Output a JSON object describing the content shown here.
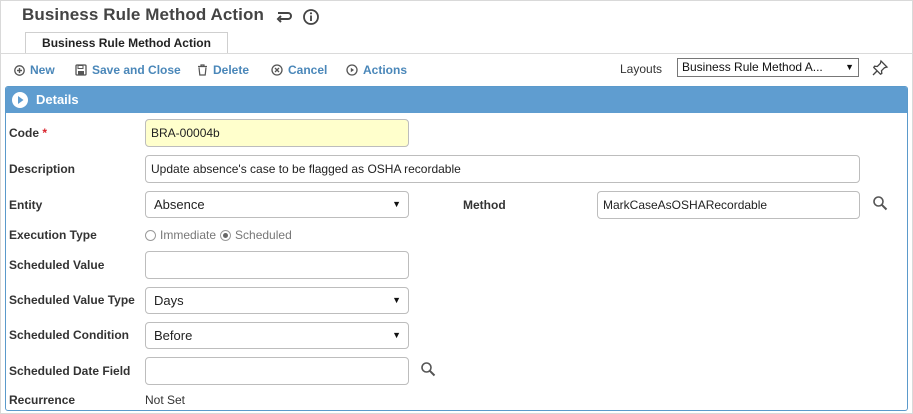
{
  "page": {
    "title": "Business Rule Method Action"
  },
  "tab": {
    "label": "Business Rule Method Action"
  },
  "toolbar": {
    "new": "New",
    "save_close": "Save and Close",
    "delete": "Delete",
    "cancel": "Cancel",
    "actions": "Actions",
    "layouts_label": "Layouts",
    "layouts_value": "Business Rule Method A..."
  },
  "section": {
    "title": "Details"
  },
  "form": {
    "code": {
      "label": "Code",
      "required_marker": "*",
      "value": "BRA-00004b"
    },
    "description": {
      "label": "Description",
      "value": "Update absence's case to be flagged as OSHA recordable"
    },
    "entity": {
      "label": "Entity",
      "value": "Absence"
    },
    "method": {
      "label": "Method",
      "value": "MarkCaseAsOSHARecordable"
    },
    "execution_type": {
      "label": "Execution Type",
      "options": [
        "Immediate",
        "Scheduled"
      ],
      "selected": "Scheduled"
    },
    "scheduled_value": {
      "label": "Scheduled Value",
      "value": ""
    },
    "scheduled_value_type": {
      "label": "Scheduled Value Type",
      "value": "Days"
    },
    "scheduled_condition": {
      "label": "Scheduled Condition",
      "value": "Before"
    },
    "scheduled_date_field": {
      "label": "Scheduled Date Field",
      "value": ""
    },
    "recurrence": {
      "label": "Recurrence",
      "value": "Not Set"
    }
  },
  "icons": {
    "back": "return-arrow-icon",
    "info": "info-icon",
    "pin": "pin-icon",
    "search": "magnifier-icon"
  },
  "colors": {
    "accent": "#4a87b9",
    "panel_header": "#5f9dd0",
    "required": "#d9242d",
    "code_field_bg": "#ffffcc"
  }
}
